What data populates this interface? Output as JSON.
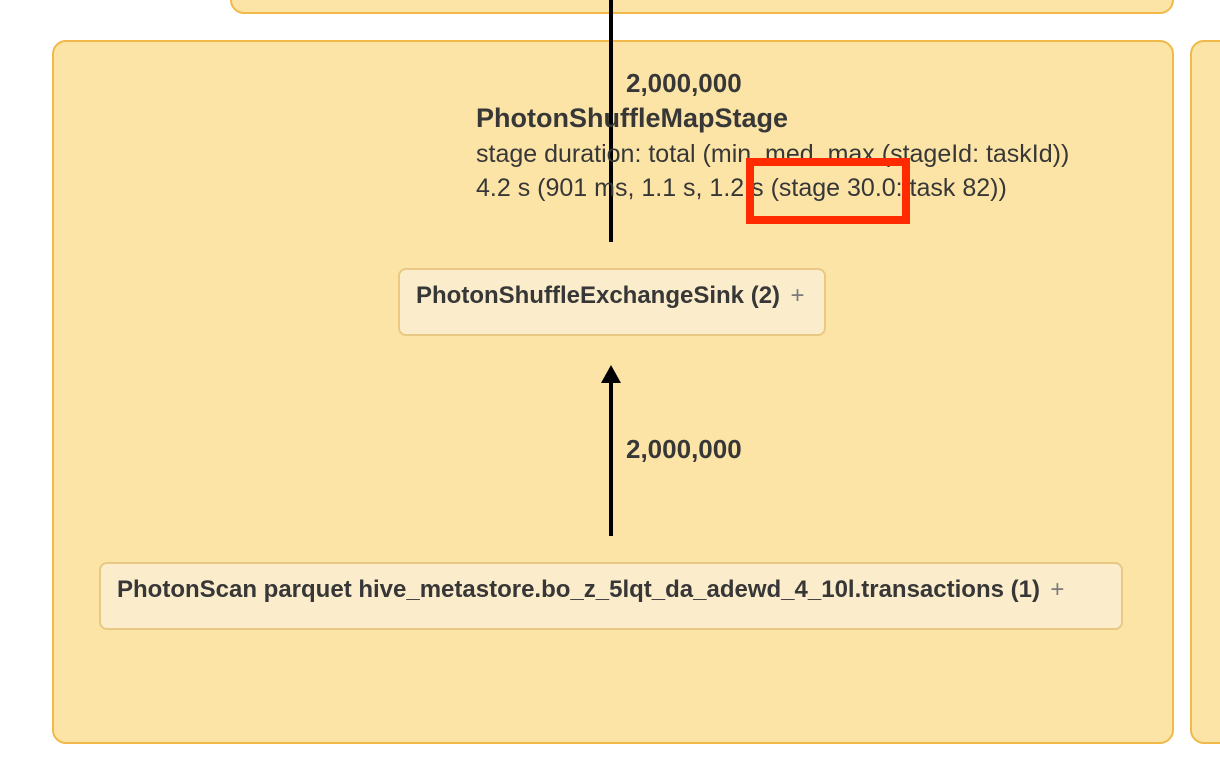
{
  "stage": {
    "top_row_count": "2,000,000",
    "name": "PhotonShuffleMapStage",
    "duration_label": "stage duration: total (min, med, max (stageId: taskId))",
    "duration_values": "4.2 s (901 ms, 1.1 s, 1.2 s (stage 30.0: task 82))"
  },
  "nodes": {
    "exchange_sink": {
      "label": "PhotonShuffleExchangeSink (2)",
      "expand": "+"
    },
    "scan": {
      "label": "PhotonScan parquet hive_metastore.bo_z_5lqt_da_adewd_4_10l.transactions (1)",
      "expand": "+"
    }
  },
  "mid_row_count": "2,000,000"
}
